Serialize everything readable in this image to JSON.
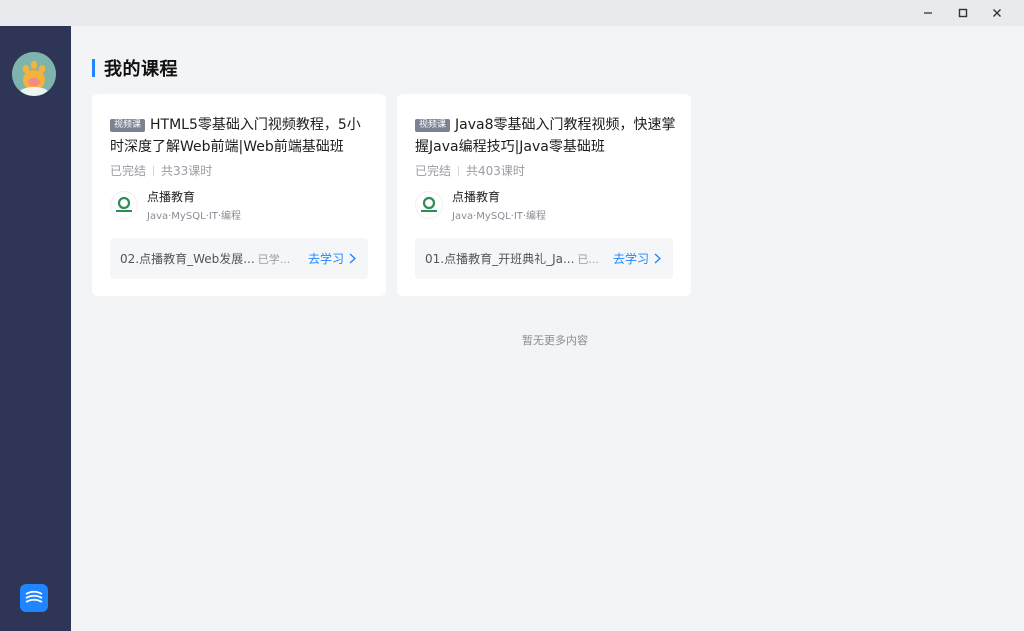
{
  "page": {
    "title": "我的课程",
    "footer_text": "暂无更多内容"
  },
  "colors": {
    "accent": "#1f86ff",
    "sidebar": "#2f3557",
    "tag_bg": "#7b8293"
  },
  "window": {
    "minimize_icon": "minimize-icon",
    "maximize_icon": "maximize-icon",
    "close_icon": "close-icon"
  },
  "courses": [
    {
      "tag": "视频课",
      "title": "HTML5零基础入门视频教程，5小时深度了解Web前端|Web前端基础班",
      "status": "已完结",
      "lessons": "共33课时",
      "institution": "点播教育",
      "institution_tags": "Java·MySQL·IT·编程",
      "last_lesson": "02.点播教育_Web发展...",
      "last_status": "已学...",
      "action": "去学习"
    },
    {
      "tag": "视频课",
      "title": "Java8零基础入门教程视频，快速掌握Java编程技巧|Java零基础班",
      "status": "已完结",
      "lessons": "共403课时",
      "institution": "点播教育",
      "institution_tags": "Java·MySQL·IT·编程",
      "last_lesson": "01.点播教育_开班典礼_Ja...",
      "last_status": "已...",
      "action": "去学习"
    }
  ]
}
